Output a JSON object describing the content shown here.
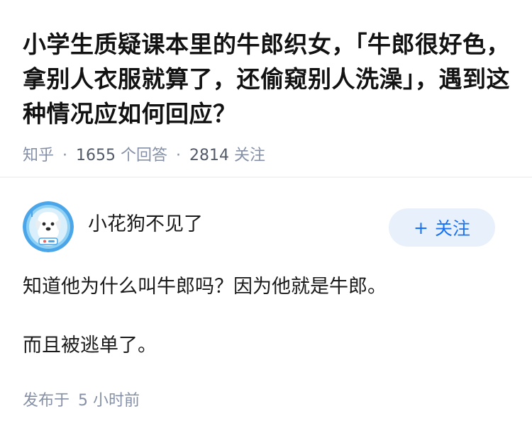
{
  "question": {
    "title": "小学生质疑课本里的牛郎织女，「牛郎很好色，拿别人衣服就算了，还偷窥别人洗澡」，遇到这种情况应如何回应？",
    "source": "知乎",
    "answer_count": "1655",
    "answer_count_label": "个回答",
    "follower_count": "2814",
    "follower_label": "关注"
  },
  "author": {
    "name": "小花狗不见了",
    "avatar_icon": "cartoon-dog-astronaut-avatar",
    "follow_label": "关注"
  },
  "answer": {
    "paragraphs": [
      "知道他为什么叫牛郎吗？因为他就是牛郎。",
      "而且被逃单了。"
    ],
    "posted_prefix": "发布于",
    "posted_time": "5 小时前"
  },
  "colors": {
    "meta_gray": "#8590a6",
    "follow_blue": "#1772f6",
    "follow_bg": "#e8f1fb"
  }
}
